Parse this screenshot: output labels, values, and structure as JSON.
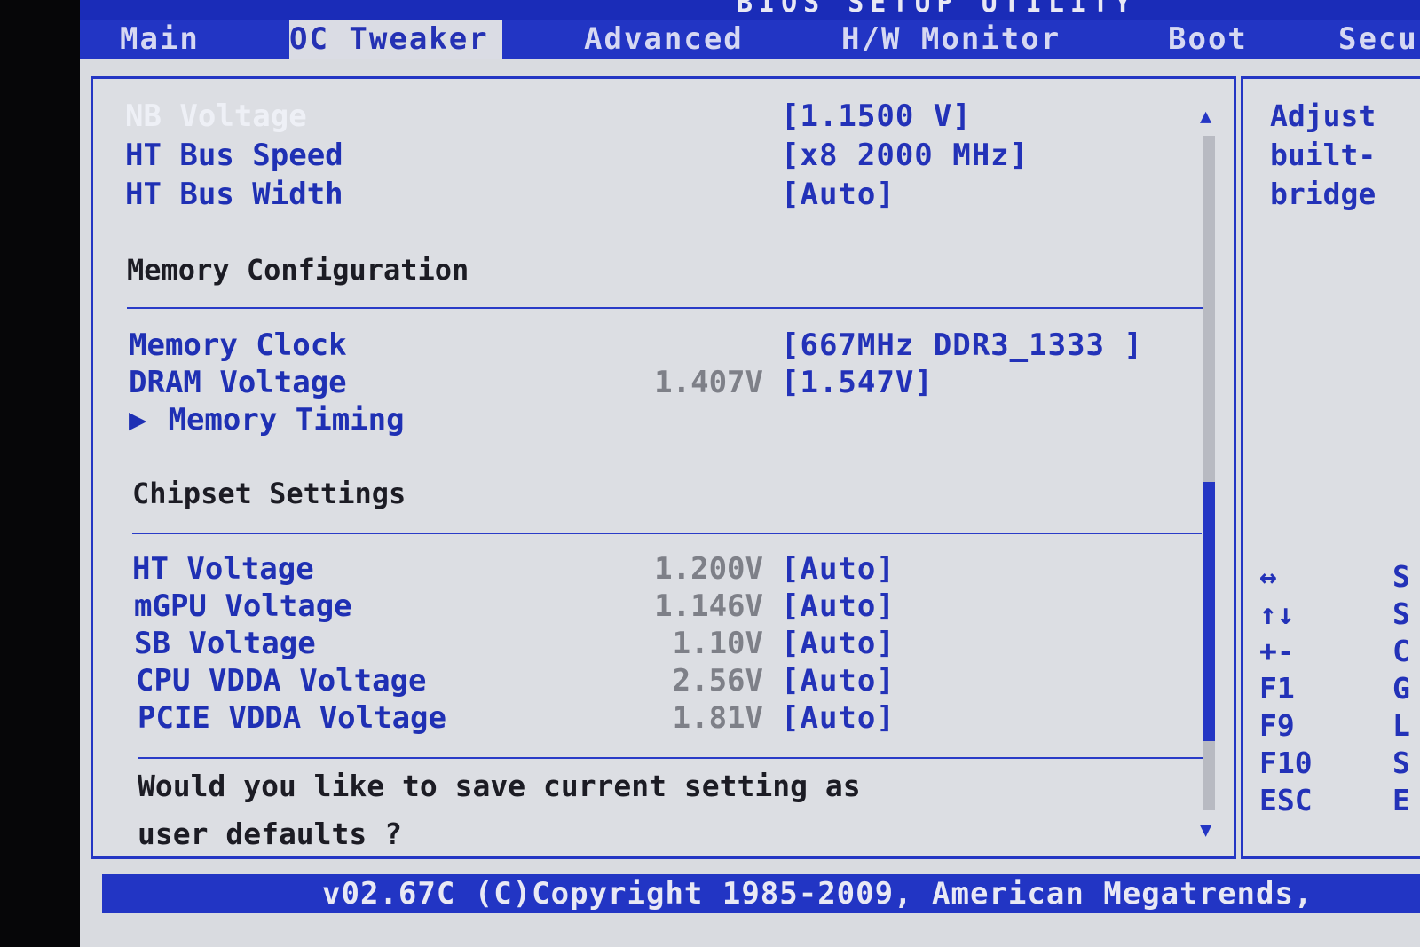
{
  "header": {
    "title": "BIOS SETUP UTILITY"
  },
  "tabs": [
    "Main",
    "OC Tweaker",
    "Advanced",
    "H/W Monitor",
    "Boot",
    "Security"
  ],
  "settings_top": [
    {
      "label": "NB Voltage",
      "reading": "",
      "value": "[1.1500 V]"
    },
    {
      "label": "HT Bus Speed",
      "reading": "",
      "value": "[x8  2000 MHz]"
    },
    {
      "label": "HT Bus Width",
      "reading": "",
      "value": "[Auto]"
    }
  ],
  "memory": {
    "section_title": "Memory Configuration",
    "items": [
      {
        "label": "Memory Clock",
        "reading": "",
        "value": "[667MHz DDR3_1333 ]"
      },
      {
        "label": "DRAM Voltage",
        "reading": "1.407V",
        "value": "[1.547V]"
      }
    ],
    "submenu_label": "Memory Timing"
  },
  "chipset": {
    "section_title": "Chipset Settings",
    "items": [
      {
        "label": "HT Voltage",
        "reading": "1.200V",
        "value": "[Auto]"
      },
      {
        "label": "mGPU Voltage",
        "reading": "1.146V",
        "value": "[Auto]"
      },
      {
        "label": "SB Voltage",
        "reading": "1.10V",
        "value": "[Auto]"
      },
      {
        "label": "CPU VDDA Voltage",
        "reading": "2.56V",
        "value": "[Auto]"
      },
      {
        "label": "PCIE VDDA Voltage",
        "reading": "1.81V",
        "value": "[Auto]"
      }
    ]
  },
  "prompt": "Would you like to save current setting as\nuser defaults ?",
  "help": {
    "text": "Adjust\nbuilt-\nbridge",
    "keys": [
      {
        "key": "↔",
        "desc": "S"
      },
      {
        "key": "↑↓",
        "desc": "S"
      },
      {
        "key": "+-",
        "desc": "C"
      },
      {
        "key": "F1",
        "desc": "G"
      },
      {
        "key": "F9",
        "desc": "L"
      },
      {
        "key": "F10",
        "desc": "S"
      },
      {
        "key": "ESC",
        "desc": "E"
      }
    ]
  },
  "footer": {
    "text": "v02.67C (C)Copyright 1985-2009, American Megatrends,"
  },
  "colors": {
    "bios_blue": "#2235c4",
    "panel_gray": "#dcdee3",
    "value_blue": "#2332b8",
    "reading_gray": "#7e8088"
  }
}
